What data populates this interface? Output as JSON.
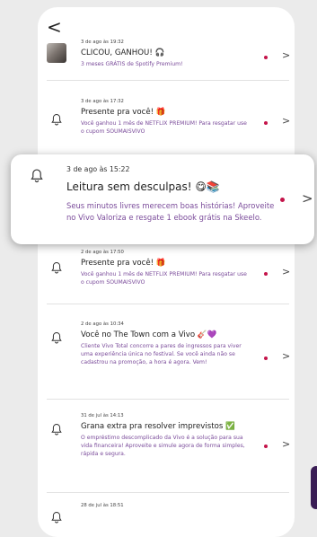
{
  "colors": {
    "dot": "#c4144a",
    "body_text": "#7a4b9a",
    "background": "#ebebeb"
  },
  "header": {
    "back_icon": "chevron-left-icon",
    "back_glyph": "<"
  },
  "chevron": ">",
  "notifications": [
    {
      "time": "3 de ago às 19:32",
      "title": "CLICOU, GANHOU!",
      "title_emoji": "🎧",
      "body": "3 meses GRÁTIS de Spotify Premium!",
      "icon": "avatar"
    },
    {
      "time": "3 de ago às 17:32",
      "title": "Presente pra você!",
      "title_emoji": "🎁",
      "body": "Você ganhou 1 mês de NETFLIX PREMIUM! Para resgatar use o cupom SOUMAISVIVO",
      "icon": "bell-icon"
    },
    {
      "time": "2 de ago às 17:50",
      "title": "Presente pra você!",
      "title_emoji": "🎁",
      "body": "Você ganhou 1 mês de NETFLIX PREMIUM! Para resgatar use o cupom SOUMAISVIVO",
      "icon": "bell-icon"
    },
    {
      "time": "2 de ago às 10:34",
      "title": "Você no The Town com a Vivo",
      "title_emoji": "🎸💜",
      "body": "Cliente Vivo Total concorre a pares de ingressos para viver uma experiência única no festival. Se você ainda não se cadastrou na promoção, a hora é agora. Vem!",
      "icon": "bell-icon"
    },
    {
      "time": "31 de jul às 14:13",
      "title": "Grana extra pra resolver imprevistos",
      "title_emoji": "✅",
      "body": "O empréstimo descomplicado da Vivo é a solução para sua vida financeira! Aproveite e simule agora de forma simples, rápida e segura.",
      "icon": "bell-icon"
    },
    {
      "time": "28 de jul às 18:51",
      "title": "",
      "title_emoji": "",
      "body": "",
      "icon": "bell-icon"
    }
  ],
  "popup": {
    "time": "3 de ago às 15:22",
    "title": "Leitura sem desculpas!",
    "title_emoji": "😋📚",
    "body": "Seus minutos livres merecem boas histórias! Aproveite no Vivo Valoriza e resgate 1 ebook grátis na Skeelo.",
    "icon": "bell-icon"
  }
}
